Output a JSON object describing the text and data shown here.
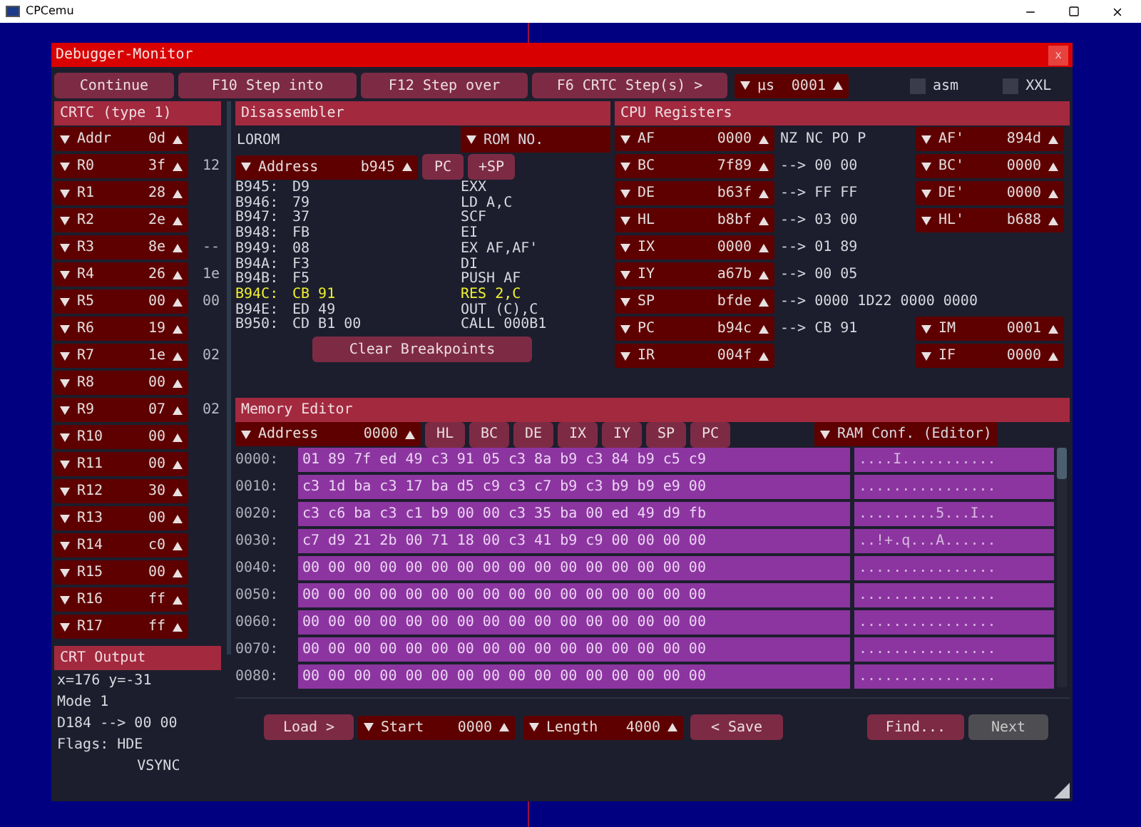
{
  "app_window": {
    "title": "CPCemu"
  },
  "debugger": {
    "title": "Debugger-Monitor",
    "close": "x"
  },
  "toolbar": {
    "buttons": [
      "Continue",
      "F10 Step into",
      "F12 Step over",
      "F6 CRTC Step(s) >"
    ],
    "step_unit": {
      "label": "µs",
      "value": "0001"
    },
    "options": [
      {
        "label": "asm",
        "checked": false
      },
      {
        "label": "XXL",
        "checked": false
      }
    ]
  },
  "crtc": {
    "title": "CRTC (type 1)",
    "registers": [
      {
        "name": "Addr",
        "value": "0d"
      },
      {
        "name": "R0",
        "value": "3f",
        "extra": "12"
      },
      {
        "name": "R1",
        "value": "28"
      },
      {
        "name": "R2",
        "value": "2e"
      },
      {
        "name": "R3",
        "value": "8e",
        "extra": "--"
      },
      {
        "name": "R4",
        "value": "26",
        "extra": "1e"
      },
      {
        "name": "R5",
        "value": "00",
        "extra": "00"
      },
      {
        "name": "R6",
        "value": "19"
      },
      {
        "name": "R7",
        "value": "1e",
        "extra": "02"
      },
      {
        "name": "R8",
        "value": "00"
      },
      {
        "name": "R9",
        "value": "07",
        "extra": "02"
      },
      {
        "name": "R10",
        "value": "00"
      },
      {
        "name": "R11",
        "value": "00"
      },
      {
        "name": "R12",
        "value": "30"
      },
      {
        "name": "R13",
        "value": "00"
      },
      {
        "name": "R14",
        "value": "c0"
      },
      {
        "name": "R15",
        "value": "00"
      },
      {
        "name": "R16",
        "value": "ff"
      },
      {
        "name": "R17",
        "value": "ff"
      }
    ]
  },
  "crt_output": {
    "title": "CRT Output",
    "lines": [
      "x=176 y=-31",
      "Mode 1",
      "D184 --> 00 00"
    ],
    "flags_label": "Flags:",
    "flags": [
      "HDE",
      "VSYNC"
    ]
  },
  "disassembler": {
    "title": "Disassembler",
    "rom_label": "LOROM",
    "rom_select": "ROM NO.",
    "address": {
      "label": "Address",
      "value": "b945"
    },
    "buttons": [
      "PC",
      "+SP"
    ],
    "lines": [
      {
        "address": "B945:",
        "bytes": "D9",
        "mnemonic": "EXX",
        "current": false
      },
      {
        "address": "B946:",
        "bytes": "79",
        "mnemonic": "LD A,C",
        "current": false
      },
      {
        "address": "B947:",
        "bytes": "37",
        "mnemonic": "SCF",
        "current": false
      },
      {
        "address": "B948:",
        "bytes": "FB",
        "mnemonic": "EI",
        "current": false
      },
      {
        "address": "B949:",
        "bytes": "08",
        "mnemonic": "EX AF,AF'",
        "current": false
      },
      {
        "address": "B94A:",
        "bytes": "F3",
        "mnemonic": "DI",
        "current": false
      },
      {
        "address": "B94B:",
        "bytes": "F5",
        "mnemonic": "PUSH AF",
        "current": false
      },
      {
        "address": "B94C:",
        "bytes": "CB 91",
        "mnemonic": "RES 2,C",
        "current": true
      },
      {
        "address": "B94E:",
        "bytes": "ED 49",
        "mnemonic": "OUT (C),C",
        "current": false
      },
      {
        "address": "B950:",
        "bytes": "CD B1 00",
        "mnemonic": "CALL 000B1",
        "current": false
      }
    ],
    "clear_button": "Clear Breakpoints"
  },
  "cpu_registers": {
    "title": "CPU Registers",
    "rows": [
      {
        "register": {
          "name": "AF",
          "value": "0000"
        },
        "info": "NZ NC PO P",
        "alt": {
          "name": "AF'",
          "value": "894d"
        }
      },
      {
        "register": {
          "name": "BC",
          "value": "7f89"
        },
        "info": "--> 00 00",
        "alt": {
          "name": "BC'",
          "value": "0000"
        }
      },
      {
        "register": {
          "name": "DE",
          "value": "b63f"
        },
        "info": "--> FF FF",
        "alt": {
          "name": "DE'",
          "value": "0000"
        }
      },
      {
        "register": {
          "name": "HL",
          "value": "b8bf"
        },
        "info": "--> 03 00",
        "alt": {
          "name": "HL'",
          "value": "b688"
        }
      },
      {
        "register": {
          "name": "IX",
          "value": "0000"
        },
        "info": "--> 01 89"
      },
      {
        "register": {
          "name": "IY",
          "value": "a67b"
        },
        "info": "--> 00 05"
      },
      {
        "register": {
          "name": "SP",
          "value": "bfde"
        },
        "info": "--> 0000 1D22 0000 0000"
      },
      {
        "register": {
          "name": "PC",
          "value": "b94c"
        },
        "info": "--> CB 91",
        "alt": {
          "name": "IM",
          "value": "0001"
        }
      },
      {
        "register": {
          "name": "IR",
          "value": "004f"
        },
        "alt": {
          "name": "IF",
          "value": "0000"
        }
      }
    ]
  },
  "memory_editor": {
    "title": "Memory Editor",
    "address": {
      "label": "Address",
      "value": "0000"
    },
    "register_buttons": [
      "HL",
      "BC",
      "DE",
      "IX",
      "IY",
      "SP",
      "PC"
    ],
    "ram_config": "RAM Conf. (Editor)",
    "rows": [
      {
        "address": "0000:",
        "hex": "01 89 7f ed 49 c3 91 05 c3 8a b9 c3 84 b9 c5 c9",
        "ascii": "....I..........."
      },
      {
        "address": "0010:",
        "hex": "c3 1d ba c3 17 ba d5 c9 c3 c7 b9 c3 b9 b9 e9 00",
        "ascii": "................"
      },
      {
        "address": "0020:",
        "hex": "c3 c6 ba c3 c1 b9 00 00 c3 35 ba 00 ed 49 d9 fb",
        "ascii": ".........5...I.."
      },
      {
        "address": "0030:",
        "hex": "c7 d9 21 2b 00 71 18 00 c3 41 b9 c9 00 00 00 00",
        "ascii": "..!+.q...A......"
      },
      {
        "address": "0040:",
        "hex": "00 00 00 00 00 00 00 00 00 00 00 00 00 00 00 00",
        "ascii": "................"
      },
      {
        "address": "0050:",
        "hex": "00 00 00 00 00 00 00 00 00 00 00 00 00 00 00 00",
        "ascii": "................"
      },
      {
        "address": "0060:",
        "hex": "00 00 00 00 00 00 00 00 00 00 00 00 00 00 00 00",
        "ascii": "................"
      },
      {
        "address": "0070:",
        "hex": "00 00 00 00 00 00 00 00 00 00 00 00 00 00 00 00",
        "ascii": "................"
      },
      {
        "address": "0080:",
        "hex": "00 00 00 00 00 00 00 00 00 00 00 00 00 00 00 00",
        "ascii": "................"
      }
    ]
  },
  "bottom_bar": {
    "load": "Load >",
    "start": {
      "label": "Start",
      "value": "0000"
    },
    "length": {
      "label": "Length",
      "value": "4000"
    },
    "save": "< Save",
    "find": "Find...",
    "next": {
      "label": "Next",
      "disabled": true
    }
  }
}
